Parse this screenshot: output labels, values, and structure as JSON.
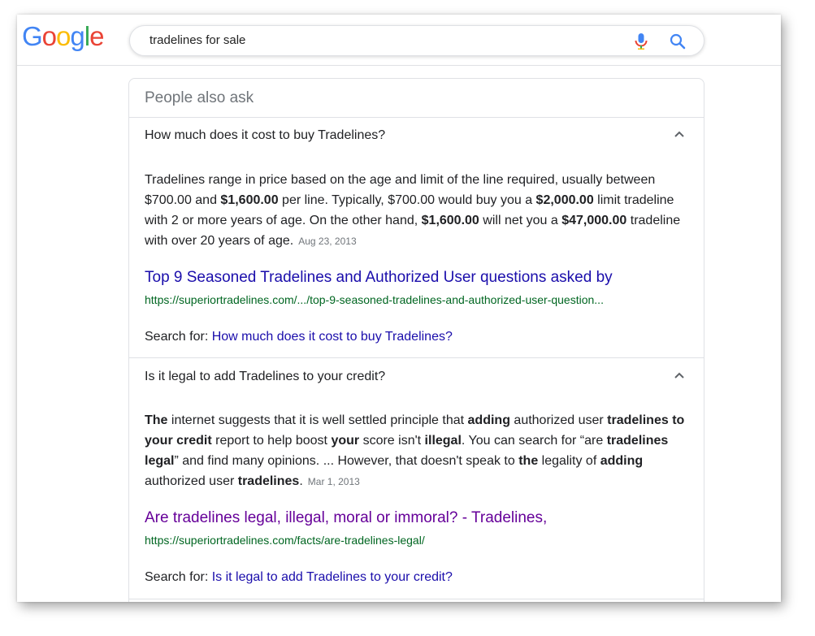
{
  "header": {
    "logo_letters": [
      {
        "char": "G",
        "color": "#4285F4"
      },
      {
        "char": "o",
        "color": "#EA4335"
      },
      {
        "char": "o",
        "color": "#FBBC05"
      },
      {
        "char": "g",
        "color": "#4285F4"
      },
      {
        "char": "l",
        "color": "#34A853"
      },
      {
        "char": "e",
        "color": "#EA4335"
      }
    ],
    "search_query": "tradelines for sale",
    "mic_icon": "microphone-icon",
    "search_icon": "magnifier-icon"
  },
  "paa": {
    "title": "People also ask",
    "items": [
      {
        "question": "How much does it cost to buy Tradelines?",
        "answer_parts": [
          {
            "t": "Tradelines range in price based on the age and limit of the line required, usually between $700.00 and ",
            "b": false
          },
          {
            "t": "$1,600.00",
            "b": true
          },
          {
            "t": " per line. Typically, $700.00 would buy you a ",
            "b": false
          },
          {
            "t": "$2,000.00",
            "b": true
          },
          {
            "t": " limit tradeline with 2 or more years of age. On the other hand, ",
            "b": false
          },
          {
            "t": "$1,600.00",
            "b": true
          },
          {
            "t": " will net you a ",
            "b": false
          },
          {
            "t": "$47,000.00",
            "b": true
          },
          {
            "t": " tradeline with over 20 years of age.",
            "b": false
          }
        ],
        "date": "Aug 23, 2013",
        "link_title": "Top 9 Seasoned Tradelines and Authorized User questions asked by",
        "link_url": "https://superiortradelines.com/.../top-9-seasoned-tradelines-and-authorized-user-question...",
        "search_for_label": "Search for:",
        "search_for_query": "How much does it cost to buy Tradelines?"
      },
      {
        "question": "Is it legal to add Tradelines to your credit?",
        "answer_parts": [
          {
            "t": "The",
            "b": true
          },
          {
            "t": " internet suggests that it is well settled principle that ",
            "b": false
          },
          {
            "t": "adding",
            "b": true
          },
          {
            "t": " authorized user ",
            "b": false
          },
          {
            "t": "tradelines to your credit",
            "b": true
          },
          {
            "t": " report to help boost ",
            "b": false
          },
          {
            "t": "your",
            "b": true
          },
          {
            "t": " score isn't ",
            "b": false
          },
          {
            "t": "illegal",
            "b": true
          },
          {
            "t": ". You can search for “are ",
            "b": false
          },
          {
            "t": "tradelines legal",
            "b": true
          },
          {
            "t": "” and find many opinions. ... However, that doesn't speak to ",
            "b": false
          },
          {
            "t": "the",
            "b": true
          },
          {
            "t": " legality of ",
            "b": false
          },
          {
            "t": "adding",
            "b": true
          },
          {
            "t": " authorized user ",
            "b": false
          },
          {
            "t": "tradelines",
            "b": true
          },
          {
            "t": ".",
            "b": false
          }
        ],
        "date": "Mar 1, 2013",
        "link_title": "Are tradelines legal, illegal, moral or immoral? - Tradelines,",
        "link_url": "https://superiortradelines.com/facts/are-tradelines-legal/",
        "search_for_label": "Search for:",
        "search_for_query": "Is it legal to add Tradelines to your credit?"
      }
    ]
  },
  "colors": {
    "link": "#1a0dab",
    "visited_link": "#660099",
    "url": "#006621",
    "muted": "#70757a"
  }
}
